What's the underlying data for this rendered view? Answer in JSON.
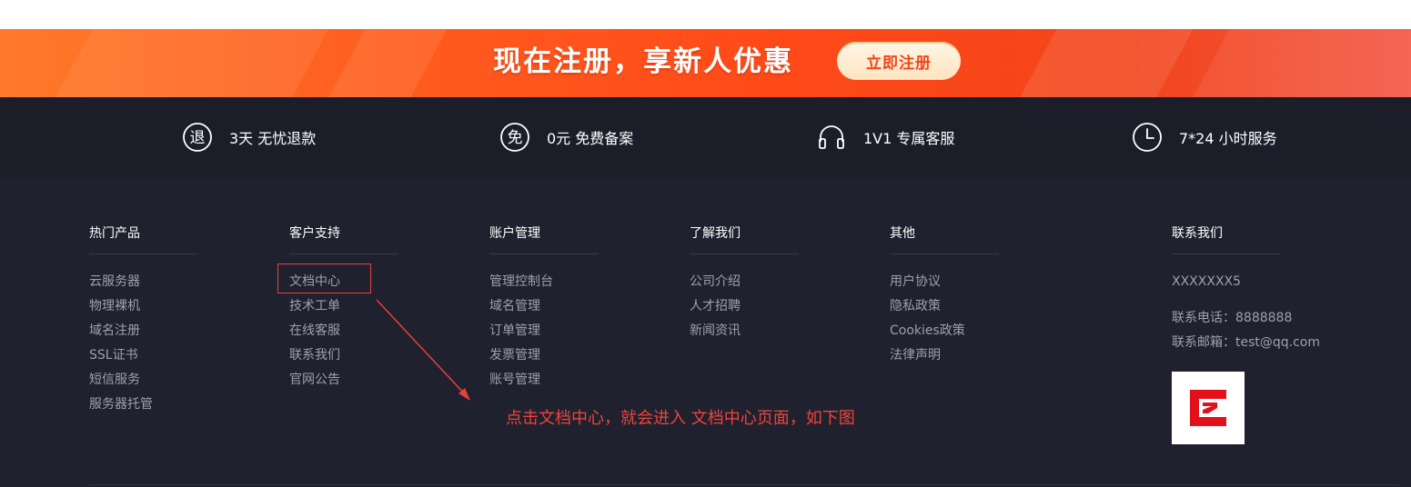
{
  "banner": {
    "title": "现在注册，享新人优惠",
    "button_label": "立即注册"
  },
  "features": [
    {
      "icon": "refund-icon",
      "glyph": "退",
      "label": "3天 无忧退款"
    },
    {
      "icon": "free-icon",
      "glyph": "免",
      "label": "0元 免费备案"
    },
    {
      "icon": "headset-icon",
      "label": "1V1 专属客服"
    },
    {
      "icon": "clock-icon",
      "label": "7*24 小时服务"
    }
  ],
  "columns": [
    {
      "title": "热门产品",
      "items": [
        "云服务器",
        "物理裸机",
        "域名注册",
        "SSL证书",
        "短信服务",
        "服务器托管"
      ]
    },
    {
      "title": "客户支持",
      "items": [
        "文档中心",
        "技术工单",
        "在线客服",
        "联系我们",
        "官网公告"
      ]
    },
    {
      "title": "账户管理",
      "items": [
        "管理控制台",
        "域名管理",
        "订单管理",
        "发票管理",
        "账号管理"
      ]
    },
    {
      "title": "了解我们",
      "items": [
        "公司介绍",
        "人才招聘",
        "新闻资讯"
      ]
    },
    {
      "title": "其他",
      "items": [
        "用户协议",
        "隐私政策",
        "Cookies政策",
        "法律声明"
      ]
    }
  ],
  "contact": {
    "title": "联系我们",
    "name": "XXXXXXX5",
    "phone": "联系电话：8888888",
    "email": "联系邮箱：test@qq.com",
    "qr_icon": "qr-logo-icon"
  },
  "annotation": {
    "text": "点击文档中心，就会进入 文档中心页面，如下图"
  },
  "colors": {
    "banner_accent": "#f2441a",
    "feature_bg": "#1b1e29",
    "footer_bg": "#1f212f",
    "link_text": "#9ea0ab",
    "annotation_red": "#e8403a"
  }
}
